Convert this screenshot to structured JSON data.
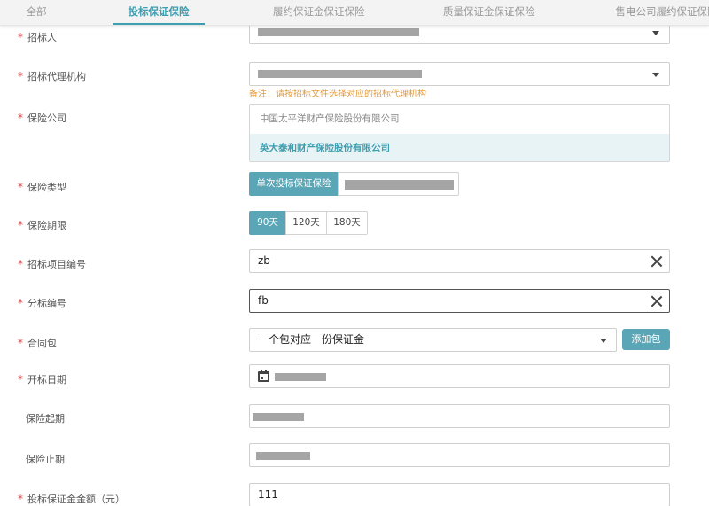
{
  "tabs": [
    {
      "label": "全部",
      "active": false
    },
    {
      "label": "投标保证保险",
      "active": true
    },
    {
      "label": "履约保证金保证保险",
      "active": false
    },
    {
      "label": "质量保证金保证保险",
      "active": false
    },
    {
      "label": "售电公司履约保证保险",
      "active": false
    }
  ],
  "form": {
    "tenderer": {
      "label": "招标人",
      "required": true,
      "value": ""
    },
    "agency": {
      "label": "招标代理机构",
      "required": true,
      "value": "",
      "note": "备注：请按招标文件选择对应的招标代理机构"
    },
    "insurer": {
      "label": "保险公司",
      "required": true,
      "options": [
        "中国太平洋财产保险股份有限公司",
        "英大泰和财产保险股份有限公司"
      ],
      "selected": "英大泰和财产保险股份有限公司"
    },
    "insurance_type": {
      "label": "保险类型",
      "required": true,
      "options": [
        "单次投标保证保险"
      ],
      "selected": "单次投标保证保险"
    },
    "insurance_period": {
      "label": "保险期限",
      "required": true,
      "options": [
        "90天",
        "120天",
        "180天"
      ],
      "selected": "90天"
    },
    "project_no": {
      "label": "招标项目编号",
      "required": true,
      "value": "zb"
    },
    "section_no": {
      "label": "分标编号",
      "required": true,
      "value": "fb"
    },
    "contract_package": {
      "label": "合同包",
      "required": true,
      "value": "一个包对应一份保证金",
      "add_label": "添加包"
    },
    "bid_open_date": {
      "label": "开标日期",
      "required": true,
      "value": ""
    },
    "start_date": {
      "label": "保险起期",
      "required": false,
      "value": ""
    },
    "end_date": {
      "label": "保险止期",
      "required": false,
      "value": ""
    },
    "amount": {
      "label": "投标保证金金额（元）",
      "required": true,
      "value": "111"
    }
  },
  "colors": {
    "accent": "#3e9eb0",
    "button": "#5aa6b6",
    "required": "#e04646",
    "note": "#e39a3a"
  },
  "icons": {
    "clear": "close-icon",
    "dropdown": "caret-down-icon",
    "date": "calendar-icon"
  }
}
